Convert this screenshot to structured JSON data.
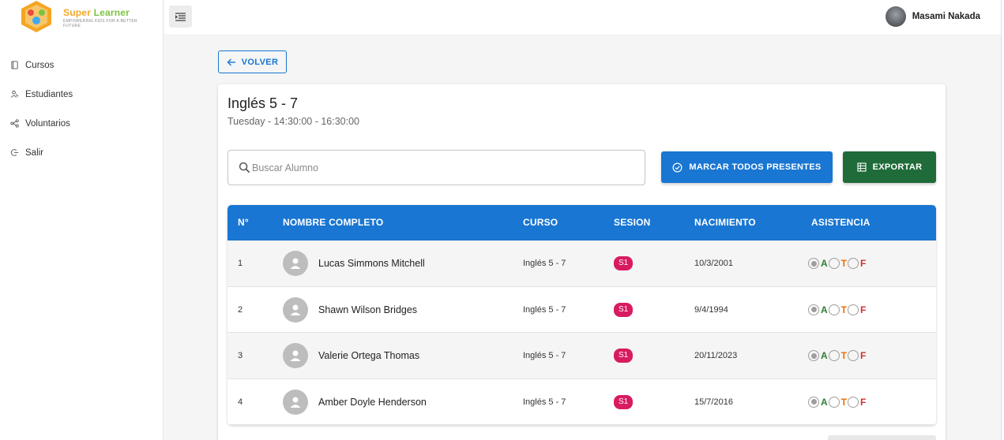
{
  "brand": {
    "name_part1": "Super",
    "name_part2": "Learner",
    "tagline": "EMPOWERING KIDS FOR A BETTER FUTURE"
  },
  "sidebar": {
    "items": [
      {
        "label": "Cursos",
        "icon": "book-icon"
      },
      {
        "label": "Estudiantes",
        "icon": "students-icon"
      },
      {
        "label": "Voluntarios",
        "icon": "network-icon"
      },
      {
        "label": "Salir",
        "icon": "logout-icon"
      }
    ]
  },
  "topbar": {
    "user_name": "Masami Nakada"
  },
  "back_label": "VOLVER",
  "course": {
    "title": "Inglés 5 - 7",
    "schedule": "Tuesday - 14:30:00 - 16:30:00"
  },
  "search": {
    "placeholder": "Buscar Alumno",
    "value": ""
  },
  "actions": {
    "mark_all_label": "MARCAR TODOS PRESENTES",
    "export_label": "EXPORTAR"
  },
  "table": {
    "columns": [
      "N°",
      "NOMBRE COMPLETO",
      "CURSO",
      "SESION",
      "NACIMIENTO",
      "ASISTENCIA"
    ],
    "attendance_options": [
      "A",
      "T",
      "F"
    ],
    "rows": [
      {
        "n": "1",
        "name": "Lucas Simmons Mitchell",
        "course": "Inglés 5 - 7",
        "session": "S1",
        "birth": "10/3/2001",
        "attendance": "A"
      },
      {
        "n": "2",
        "name": "Shawn Wilson Bridges",
        "course": "Inglés 5 - 7",
        "session": "S1",
        "birth": "9/4/1994",
        "attendance": "A"
      },
      {
        "n": "3",
        "name": "Valerie Ortega Thomas",
        "course": "Inglés 5 - 7",
        "session": "S1",
        "birth": "20/11/2023",
        "attendance": "A"
      },
      {
        "n": "4",
        "name": "Amber Doyle Henderson",
        "course": "Inglés 5 - 7",
        "session": "S1",
        "birth": "15/7/2016",
        "attendance": "A"
      }
    ]
  },
  "colors": {
    "primary": "#1976d2",
    "export": "#1f6b39",
    "badge": "#d81b60",
    "present": "#2e7d32",
    "late": "#ef6c00",
    "absent": "#d32f2f"
  }
}
